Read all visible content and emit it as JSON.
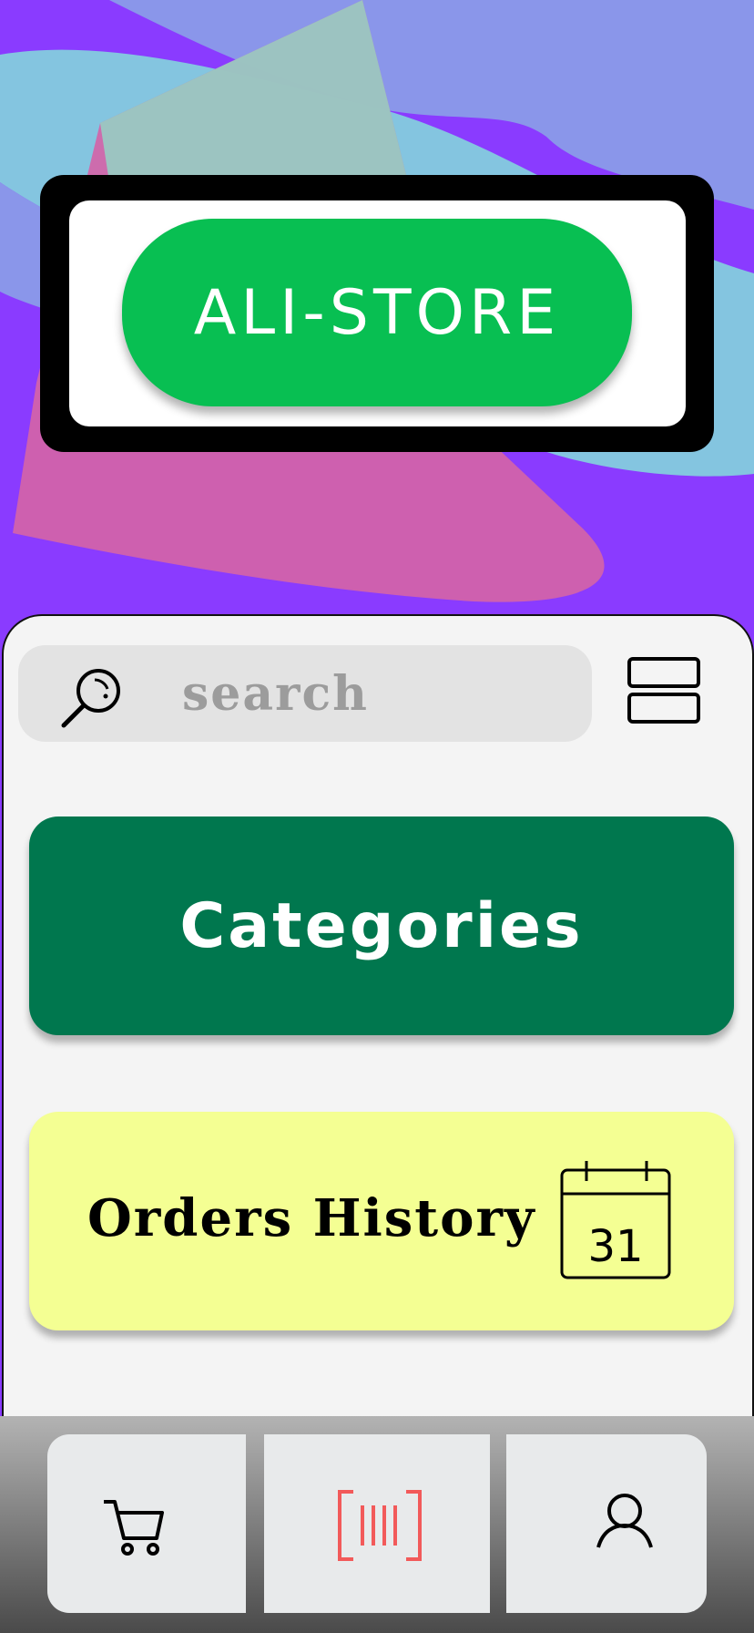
{
  "logo": {
    "text": "ALI-STORE"
  },
  "search": {
    "placeholder": "search",
    "icon": "search-icon"
  },
  "menu": {
    "icon": "menu-icon"
  },
  "categories": {
    "label": "Categories",
    "color": "#00774e"
  },
  "orders": {
    "label": "Orders History",
    "calendar_day": "31",
    "color": "#f4ff93"
  },
  "bottom_nav": [
    {
      "icon": "cart-icon"
    },
    {
      "icon": "barcode-scan-icon",
      "color": "#f25a5a"
    },
    {
      "icon": "user-icon"
    }
  ],
  "colors": {
    "brand_green": "#08bf52",
    "background_purple": "#8a3bff"
  }
}
